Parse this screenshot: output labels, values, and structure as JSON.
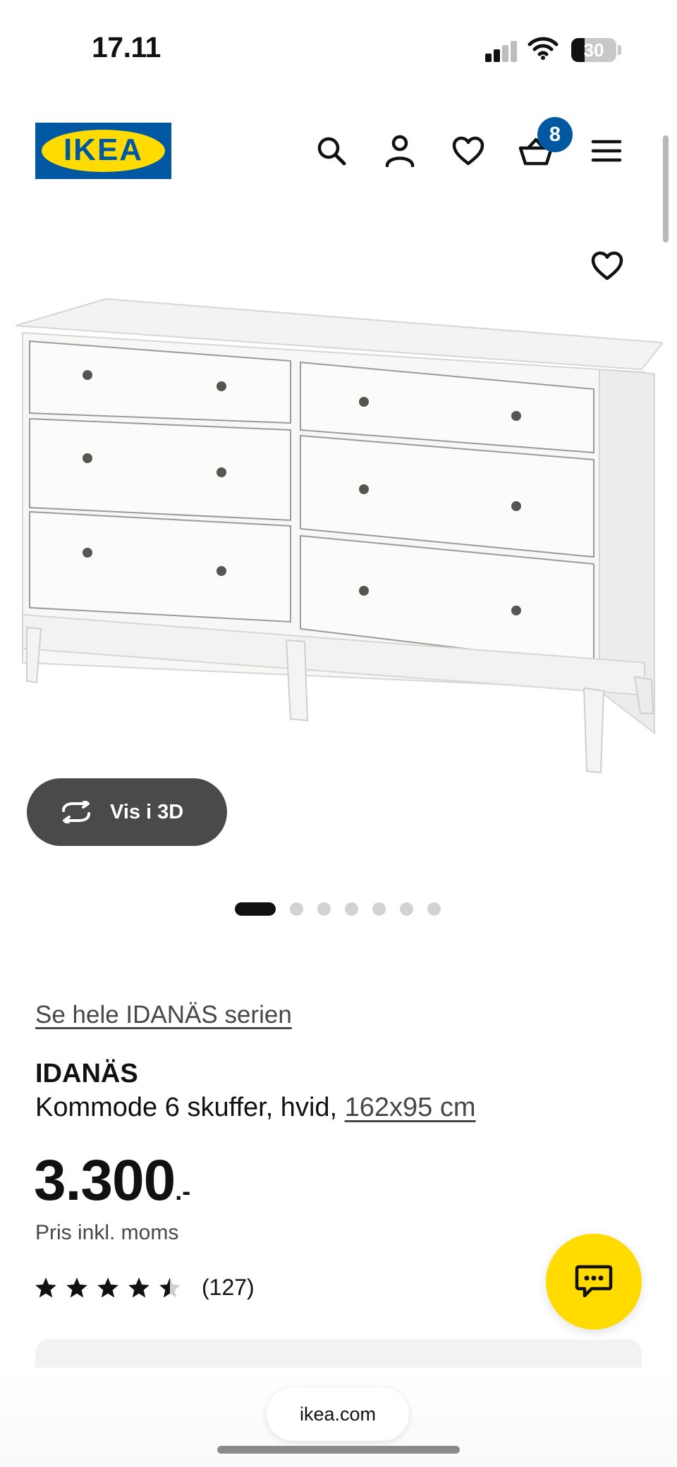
{
  "status_bar": {
    "time": "17.11",
    "battery": "30"
  },
  "header": {
    "logo_text": "IKEA",
    "cart_count": "8"
  },
  "product_media": {
    "view_3d_label": "Vis i 3D",
    "image_count": 7,
    "active_image_index": 0
  },
  "product": {
    "series_link": "Se hele IDANÄS serien",
    "name": "IDANÄS",
    "description": "Kommode 6 skuffer, hvid,",
    "dimensions": "162x95 cm",
    "price": "3.300",
    "price_suffix": ".-",
    "price_note": "Pris inkl. moms",
    "rating_stars": 4.5,
    "rating_max": 5,
    "review_count": "(127)"
  },
  "browser": {
    "url": "ikea.com"
  },
  "colors": {
    "ikea_blue": "#0058a3",
    "ikea_yellow": "#ffdb00",
    "button_dark": "#4a4a4a",
    "text_primary": "#111111",
    "text_secondary": "#484848"
  },
  "icons": [
    "signal-icon",
    "wifi-icon",
    "battery-icon",
    "search-icon",
    "account-icon",
    "heart-icon",
    "basket-icon",
    "menu-icon",
    "wishlist-heart-icon",
    "rotate-3d-icon",
    "star-icon",
    "chat-icon"
  ]
}
